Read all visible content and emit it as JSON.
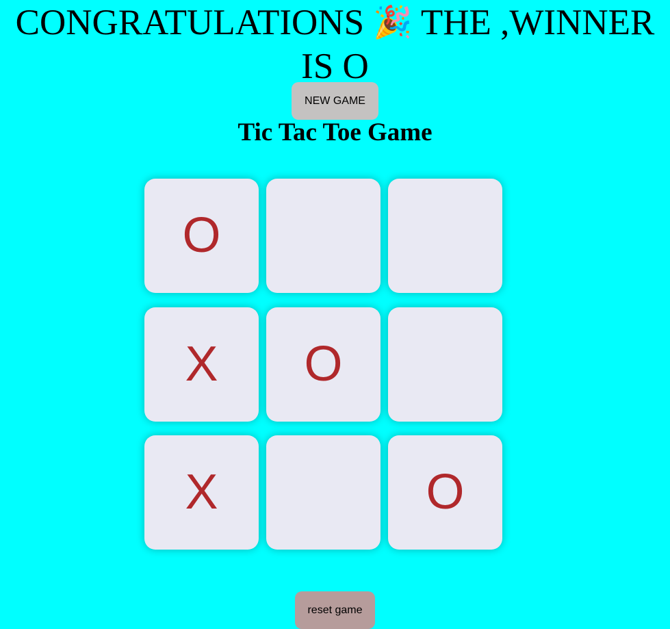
{
  "winner_message": {
    "line1_before_icon": "CONGRATULATIONS",
    "icon": "party-popper-icon",
    "icon_glyph": "🎉",
    "line1_after_icon": "THE ,WINNER",
    "line2": "IS O"
  },
  "new_game_label": "NEW GAME",
  "game_title": "Tic Tac Toe Game",
  "board": {
    "cells": [
      "O",
      "",
      "",
      "X",
      "O",
      "",
      "X",
      "",
      "O"
    ]
  },
  "reset_label": "reset game",
  "colors": {
    "background": "#00ffff",
    "cell_background": "#e9e9f3",
    "mark_color": "#b0282b",
    "new_game_button": "#c4c2c1",
    "reset_button": "#b69c9b"
  }
}
